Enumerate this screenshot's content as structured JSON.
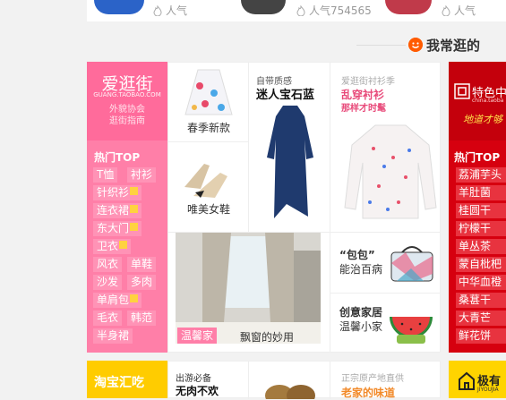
{
  "top_strip": {
    "items": [
      {
        "label": "人气"
      },
      {
        "label": "人气754565"
      },
      {
        "label": "人气"
      }
    ]
  },
  "section": {
    "title": "我常逛的"
  },
  "pink_panel": {
    "logo_title": "爱逛街",
    "logo_url": "GUANG.TAOBAO.COM",
    "logo_sub1": "外貌协会",
    "logo_sub2": "逛街指南",
    "hot_label": "热门TOP",
    "tags": [
      "T恤",
      "衬衫",
      "针织衫",
      "连衣裙",
      "东大门",
      "卫衣",
      "风衣",
      "单鞋",
      "沙发",
      "多肉",
      "单肩包",
      "毛衣",
      "韩范",
      "半身裙"
    ]
  },
  "grid": {
    "skirt_label": "春季新款",
    "shoes_label": "唯美女鞋",
    "col2_top": "自带质感",
    "col2_title": "迷人宝石蓝",
    "col3_top": "爱逛街衬衫季",
    "col3_title1": "乱穿衬衫",
    "col3_title2": "那样才时髦",
    "home_badge": "温馨家",
    "home_caption": "飘窗的妙用",
    "bag_title": "“包包”",
    "bag_sub": "能治百病",
    "deco_title": "创意家居",
    "deco_sub": "温馨小家"
  },
  "red_panel": {
    "logo_title": "特色中",
    "logo_sub": "china.taoba",
    "logo_slogan": "地道才够",
    "hot_label": "热门TOP",
    "tags": [
      "荔浦芋头",
      "羊肚菌",
      "桂圆干",
      "柠檬干",
      "单丛茶",
      "蒙自枇杷",
      "中华血橙",
      "桑葚干",
      "大青芒",
      "鲜花饼"
    ]
  },
  "bottom": {
    "left_title": "淘宝汇吃",
    "c1_top": "出游必备",
    "c1_title": "无肉不欢",
    "c3_top": "正宗原产地直供",
    "c3_title": "老家的味道",
    "right_title": "极有",
    "right_sub": "JIYOUJIA"
  },
  "colors": {
    "pink": "#ff7fa8",
    "red": "#d6000f",
    "yellow": "#ffd400",
    "accent": "#ff5b00"
  }
}
